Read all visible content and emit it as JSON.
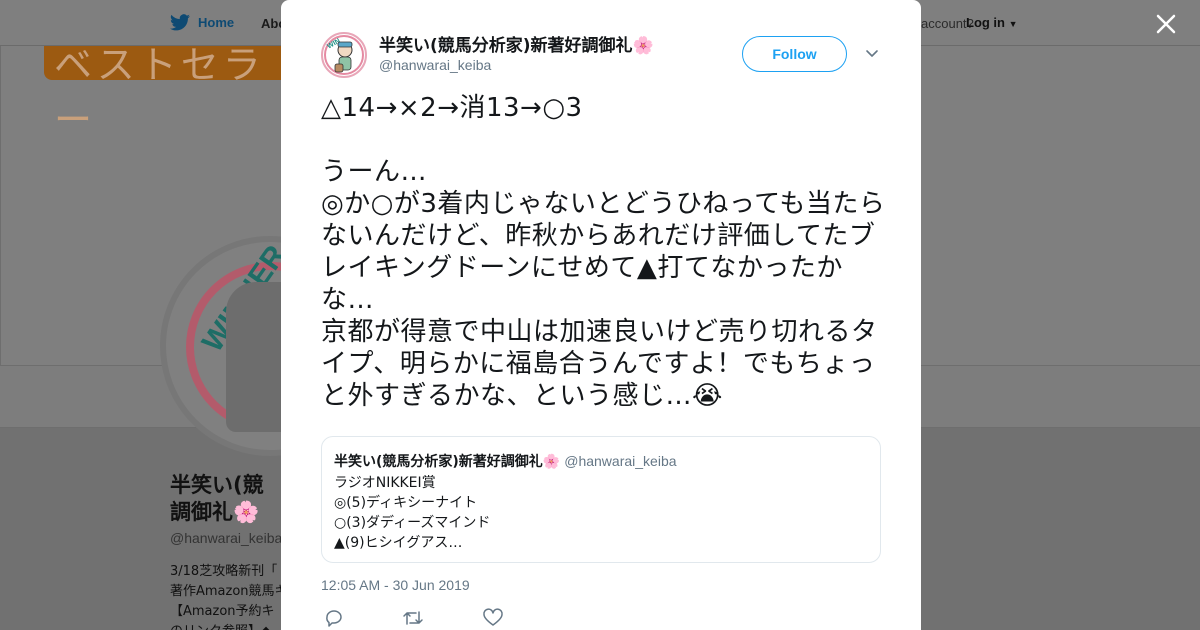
{
  "background": {
    "nav": {
      "home_label": "Home",
      "about_label": "Abo",
      "account_text": "account?",
      "login_label": "Log in"
    },
    "banner_text": "ベストセラー",
    "profile": {
      "name_line1": "半笑い(競",
      "name_line2": "調御礼",
      "handle": "@hanwarai_keiba",
      "bio_lines": [
        "3/18芝攻略新刊「",
        "著作Amazon競馬キ",
        "【Amazon予約キ",
        "のリンク参照】◆"
      ]
    }
  },
  "tweet": {
    "author_name": "半笑い(競馬分析家)新著好調御礼",
    "author_emoji": "🌸",
    "author_handle": "@hanwarai_keiba",
    "follow_label": "Follow",
    "text": "△14→×2→消13→○3\n\nうーん…\n◎か○が3着内じゃないとどうひねっても当たらないんだけど、昨秋からあれだけ評価してたブレイキングドーンにせめて▲打てなかったかな…\n京都が得意で中山は加速良いけど売り切れるタイプ、明らかに福島合うんですよ！でもちょっと外すぎるかな、という感じ…",
    "text_emoji": "😭",
    "quote": {
      "author_name": "半笑い(競馬分析家)新著好調御礼",
      "author_emoji": "🌸",
      "author_handle": "@hanwarai_keiba",
      "lines": [
        "ラジオNIKKEI賞",
        "◎(5)ディキシーナイト",
        "○(3)ダディーズマインド",
        "▲(9)ヒシイグアス…"
      ]
    },
    "timestamp": "12:05 AM - 30 Jun 2019"
  },
  "colors": {
    "accent": "#1da1f2",
    "secondary_text": "#657786",
    "overlay": "#7f7f7f"
  },
  "icons": [
    "twitter-bird-icon",
    "close-icon",
    "chevron-down-icon",
    "reply-icon",
    "retweet-icon",
    "like-icon"
  ]
}
